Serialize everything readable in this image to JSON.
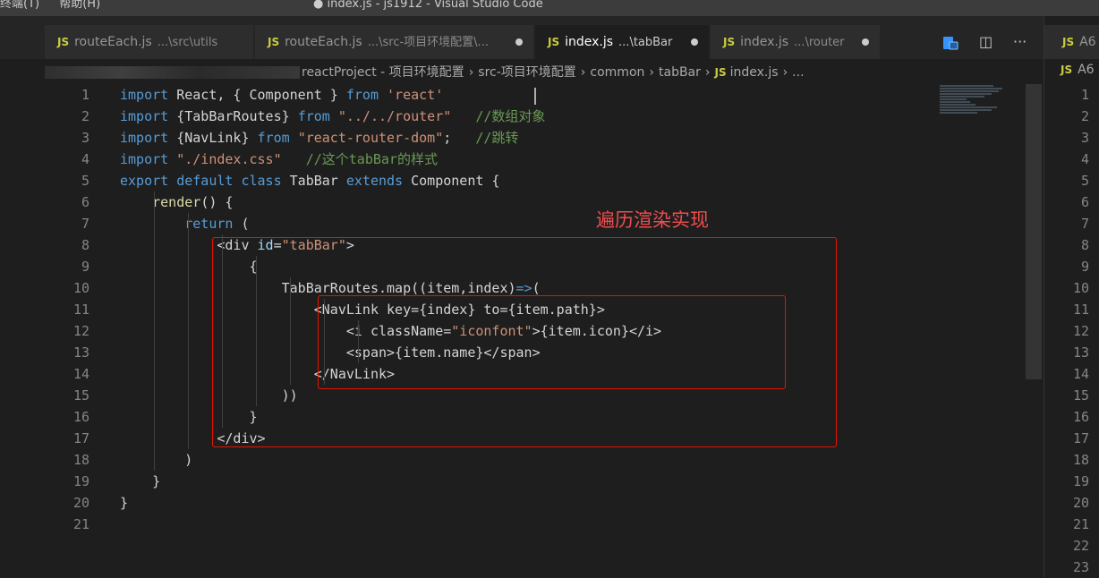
{
  "menu": [
    "终端(T)",
    "帮助(H)"
  ],
  "window_title": "● index.js - js1912 - Visual Studio Code",
  "tabs": [
    {
      "badge": "JS",
      "name": "routeEach.js",
      "path": "...\\src\\utils",
      "modified": false
    },
    {
      "badge": "JS",
      "name": "routeEach.js",
      "path": "...\\src-项目环境配置\\...",
      "modified": true
    },
    {
      "badge": "JS",
      "name": "index.js",
      "path": "...\\tabBar",
      "modified": true,
      "active": true
    },
    {
      "badge": "JS",
      "name": "index.js",
      "path": "...\\router",
      "modified": true
    }
  ],
  "tab_actions": [
    "compare-icon",
    "split-editor-icon",
    "more-icon"
  ],
  "tab_actions_glyphs": {
    "split": "◫",
    "more": "···"
  },
  "breadcrumb": {
    "segments": [
      "reactProject - 项目环境配置",
      "src-项目环境配置",
      "common",
      "tabBar"
    ],
    "file_badge": "JS",
    "file": "index.js",
    "tail": "..."
  },
  "code": {
    "lines": [
      {
        "n": "1",
        "tokens": [
          [
            "kw",
            "import"
          ],
          [
            "",
            " React, { Component } "
          ],
          [
            "kw",
            "from"
          ],
          [
            "",
            " "
          ],
          [
            "str",
            "'react'"
          ]
        ]
      },
      {
        "n": "2",
        "tokens": [
          [
            "kw",
            "import"
          ],
          [
            "",
            " {TabBarRoutes} "
          ],
          [
            "kw",
            "from"
          ],
          [
            "",
            " "
          ],
          [
            "str",
            "\"../../router\""
          ],
          [
            "",
            "   "
          ],
          [
            "cmt",
            "//数组对象"
          ]
        ]
      },
      {
        "n": "3",
        "tokens": [
          [
            "kw",
            "import"
          ],
          [
            "",
            " {NavLink} "
          ],
          [
            "kw",
            "from"
          ],
          [
            "",
            " "
          ],
          [
            "str",
            "\"react-router-dom\""
          ],
          [
            "",
            ";   "
          ],
          [
            "cmt",
            "//跳转"
          ]
        ]
      },
      {
        "n": "4",
        "tokens": [
          [
            "kw",
            "import"
          ],
          [
            "",
            " "
          ],
          [
            "str",
            "\"./index.css\""
          ],
          [
            "",
            "   "
          ],
          [
            "cmt",
            "//这个tabBar的样式"
          ]
        ]
      },
      {
        "n": "5",
        "tokens": [
          [
            "kw",
            "export"
          ],
          [
            "",
            " "
          ],
          [
            "kw",
            "default"
          ],
          [
            "",
            " "
          ],
          [
            "kw",
            "class"
          ],
          [
            "",
            " TabBar "
          ],
          [
            "kw",
            "extends"
          ],
          [
            "",
            " Component {"
          ]
        ]
      },
      {
        "n": "6",
        "tokens": [
          [
            "",
            "    "
          ],
          [
            "fn",
            "render"
          ],
          [
            "",
            "() {"
          ]
        ]
      },
      {
        "n": "7",
        "tokens": [
          [
            "",
            "        "
          ],
          [
            "kw",
            "return"
          ],
          [
            "",
            " ("
          ]
        ]
      },
      {
        "n": "8",
        "tokens": [
          [
            "",
            "            <div "
          ],
          [
            "var",
            "id"
          ],
          [
            "",
            "="
          ],
          [
            "str",
            "\"tabBar\""
          ],
          [
            "",
            ">"
          ]
        ]
      },
      {
        "n": "9",
        "tokens": [
          [
            "",
            "                {"
          ]
        ]
      },
      {
        "n": "10",
        "tokens": [
          [
            "",
            "                    TabBarRoutes.map((item,index)"
          ],
          [
            "kw",
            "=>"
          ],
          [
            "",
            "("
          ]
        ]
      },
      {
        "n": "11",
        "tokens": [
          [
            "",
            "                        <NavLink key={index} to={item.path}>"
          ]
        ]
      },
      {
        "n": "12",
        "tokens": [
          [
            "",
            "                            <i className="
          ],
          [
            "str",
            "\"iconfont\""
          ],
          [
            "",
            ">{item.icon}</i>"
          ]
        ]
      },
      {
        "n": "13",
        "tokens": [
          [
            "",
            "                            <span>{item.name}</span>"
          ]
        ]
      },
      {
        "n": "14",
        "tokens": [
          [
            "",
            "                        </NavLink>"
          ]
        ]
      },
      {
        "n": "15",
        "tokens": [
          [
            "",
            "                    ))"
          ]
        ]
      },
      {
        "n": "16",
        "tokens": [
          [
            "",
            "                }"
          ]
        ]
      },
      {
        "n": "17",
        "tokens": [
          [
            "",
            "            </div>"
          ]
        ]
      },
      {
        "n": "18",
        "tokens": [
          [
            "",
            "        )"
          ]
        ]
      },
      {
        "n": "19",
        "tokens": [
          [
            "",
            "    }"
          ]
        ]
      },
      {
        "n": "20",
        "tokens": [
          [
            "",
            "}"
          ]
        ]
      },
      {
        "n": "21",
        "tokens": []
      }
    ]
  },
  "annotation": "遍历渲染实现",
  "right_pane": {
    "tab_badge": "JS",
    "tab_label": "A6",
    "breadcrumb_badge": "JS",
    "breadcrumb_label": "A6",
    "line_numbers": [
      "1",
      "2",
      "3",
      "4",
      "5",
      "6",
      "7",
      "8",
      "9",
      "10",
      "11",
      "12",
      "13",
      "14",
      "15",
      "16",
      "17",
      "18",
      "19",
      "20",
      "21",
      "22",
      "23"
    ]
  },
  "colors": {
    "accent_red": "#e51400",
    "keyword": "#569cd6",
    "string": "#ce9178",
    "comment": "#6a9955"
  }
}
